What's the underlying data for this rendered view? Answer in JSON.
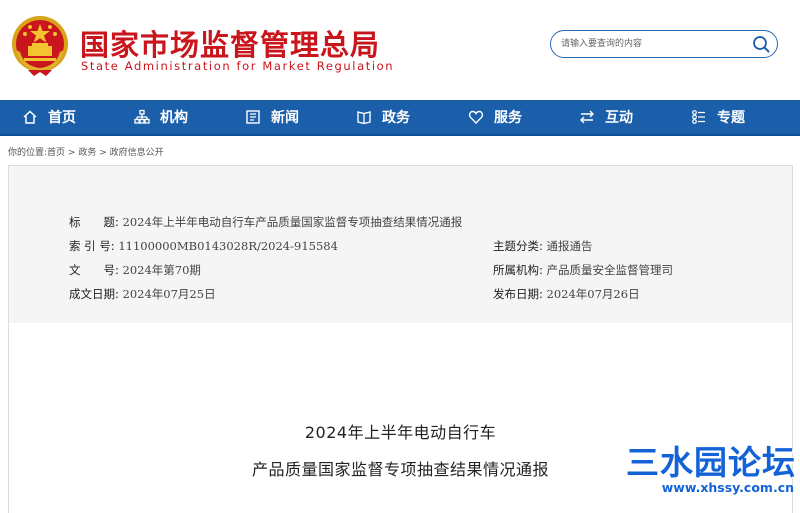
{
  "header": {
    "title_cn": "国家市场监督管理总局",
    "title_en": "State Administration for Market Regulation",
    "brand_color": "#c9161d",
    "emblem_icon": "national-emblem-icon"
  },
  "search": {
    "placeholder": "请输入要查询的内容",
    "icon": "search-icon"
  },
  "nav": {
    "background": "#1b5eaa",
    "items": [
      {
        "label": "首页",
        "icon": "home-icon"
      },
      {
        "label": "机构",
        "icon": "org-chart-icon"
      },
      {
        "label": "新闻",
        "icon": "news-icon"
      },
      {
        "label": "政务",
        "icon": "government-affairs-icon"
      },
      {
        "label": "服务",
        "icon": "heart-icon"
      },
      {
        "label": "互动",
        "icon": "exchange-arrows-icon"
      },
      {
        "label": "专题",
        "icon": "topics-icon"
      }
    ]
  },
  "breadcrumb": {
    "prefix": "你的位置:",
    "items": [
      "首页",
      "政务",
      "政府信息公开"
    ],
    "separator": " > "
  },
  "info": {
    "title_label": "标　　题:",
    "title_value": "2024年上半年电动自行车产品质量国家监督专项抽查结果情况通报",
    "index_label": "索 引 号:",
    "index_value": "11100000MB0143028R/2024-915584",
    "doc_no_label": "文　　号:",
    "doc_no_value": "2024年第70期",
    "created_label": "成文日期:",
    "created_value": "2024年07月25日",
    "category_label": "主题分类:",
    "category_value": "通报通告",
    "agency_label": "所属机构:",
    "agency_value": "产品质量安全监督管理司",
    "published_label": "发布日期:",
    "published_value": "2024年07月26日"
  },
  "article": {
    "title_line1": "2024年上半年电动自行车",
    "title_line2": "产品质量国家监督专项抽查结果情况通报"
  },
  "watermark": {
    "text": "三水园论坛",
    "url": "www.xhssy.com.cn",
    "color": "#1363d6"
  }
}
